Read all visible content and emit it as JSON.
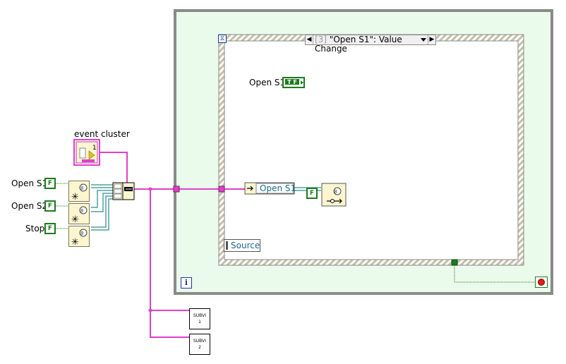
{
  "controls": [
    {
      "label": "Open S1",
      "const": "F"
    },
    {
      "label": "Open S2",
      "const": "F"
    },
    {
      "label": "Stop",
      "const": "F"
    }
  ],
  "event_cluster": {
    "label": "event cluster",
    "index": "1"
  },
  "event_case": {
    "case_number": "[3]",
    "case_name": "\"Open S1\": Value Change",
    "terminal_label": "Open S1",
    "terminal_value": "T F",
    "property_label": "Open S1",
    "false_const": "F",
    "source_label": "Source"
  },
  "while_loop": {
    "iteration_label": "i"
  },
  "subvis": [
    {
      "line1": "SUBVI",
      "line2": "1"
    },
    {
      "line1": "SUBVI",
      "line2": "2"
    }
  ],
  "colors": {
    "loop_fill": "#ebfbeb",
    "loop_border": "#8a8a8a",
    "wire_cluster": "#e040c8",
    "wire_refnum": "#50a0a0",
    "wire_bool": "#1e7a1e",
    "stop_red": "#e02020"
  }
}
